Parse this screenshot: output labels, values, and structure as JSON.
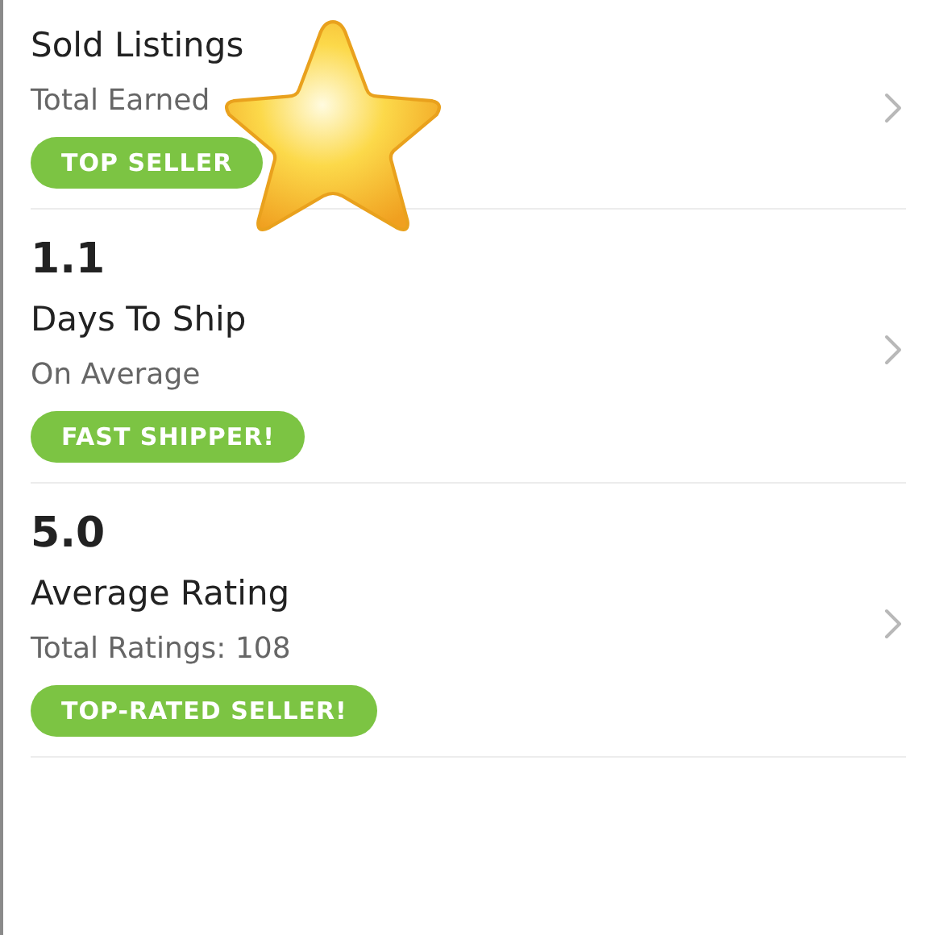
{
  "stats": [
    {
      "title": "Sold Listings",
      "subtitle": "Total Earned",
      "badge": "TOP SELLER"
    },
    {
      "value": "1.1",
      "title": "Days To Ship",
      "subtitle": "On Average",
      "badge": "FAST SHIPPER!"
    },
    {
      "value": "5.0",
      "title": "Average Rating",
      "subtitle": "Total Ratings: 108",
      "badge": "TOP-RATED SELLER!"
    }
  ],
  "sticker": {
    "kind": "star"
  }
}
